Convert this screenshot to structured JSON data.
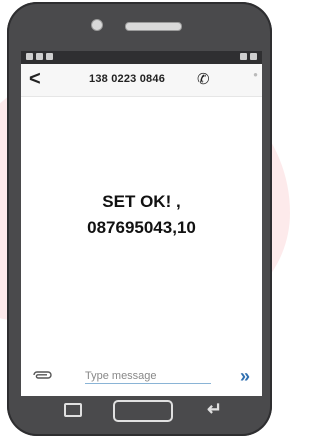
{
  "header": {
    "back_icon": "chevron-left-icon",
    "back_glyph": "<",
    "phone_number": "138 0223 0846",
    "call_icon": "phone-icon",
    "call_glyph": "✆"
  },
  "message": {
    "line1": "SET OK! ,",
    "line2": "087695043,10"
  },
  "composer": {
    "attach_icon": "paperclip-icon",
    "attach_glyph": "⌇",
    "placeholder": "Type message",
    "send_icon": "send-icon",
    "send_glyph": "»"
  },
  "colors": {
    "phone_body": "#4a4a4c",
    "send_accent": "#2f6fb0"
  }
}
